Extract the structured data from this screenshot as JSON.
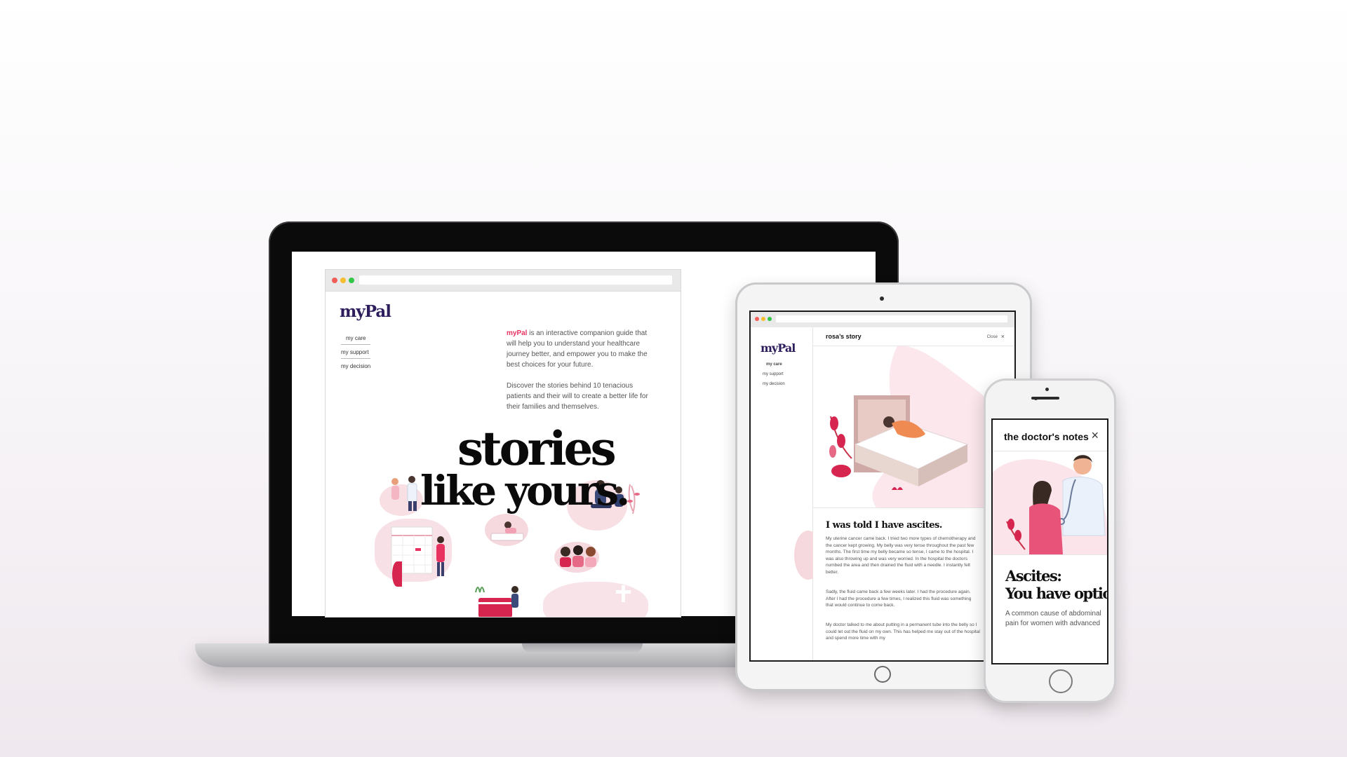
{
  "colors": {
    "brand": "#2e1d5c",
    "accent": "#e8325f",
    "illustration_pink": "#f6d9df",
    "illustration_red": "#d6264f"
  },
  "laptop": {
    "brand": "myPal",
    "nav": [
      "my care",
      "my support",
      "my decision"
    ],
    "intro_brand": "myPal",
    "intro_text": " is an interactive companion guide that will help you to understand your healthcare journey better, and empower you to make the best choices for your future.",
    "intro_text_2": "Discover the stories behind 10 tenacious patients and their will to create a better life for their families and themselves.",
    "hero_line1": "stories",
    "hero_line2": "like yours."
  },
  "tablet": {
    "brand": "myPal",
    "nav": [
      "my care",
      "my support",
      "my decision"
    ],
    "panel_title": "rosa’s story",
    "close_label": "Close",
    "story_heading": "I was told I have ascites.",
    "story_p1": "My uterine cancer came back. I tried two more types of chemotherapy and the cancer kept growing. My belly was very tense throughout the past few months. The first time my belly became so tense, I came to the hospital. I was also throwing up and was very worried. In the hospital the doctors numbed the area and then drained the fluid with a needle. I instantly felt better.",
    "story_p2": "Sadly, the fluid came back a few weeks later. I had the procedure again. After I had the procedure a few times, I realized this fluid was something that would continue to come back.",
    "story_p3": "My doctor talked to me about putting in a permanent tube into the belly so I could let out the fluid on my own. This has helped me stay out of the hospital and spend more time with my"
  },
  "phone": {
    "panel_title": "the doctor's notes",
    "heading_line1": "Ascites:",
    "heading_line2": "You have options.",
    "body": "A common cause of abdominal pain for women with advanced"
  }
}
